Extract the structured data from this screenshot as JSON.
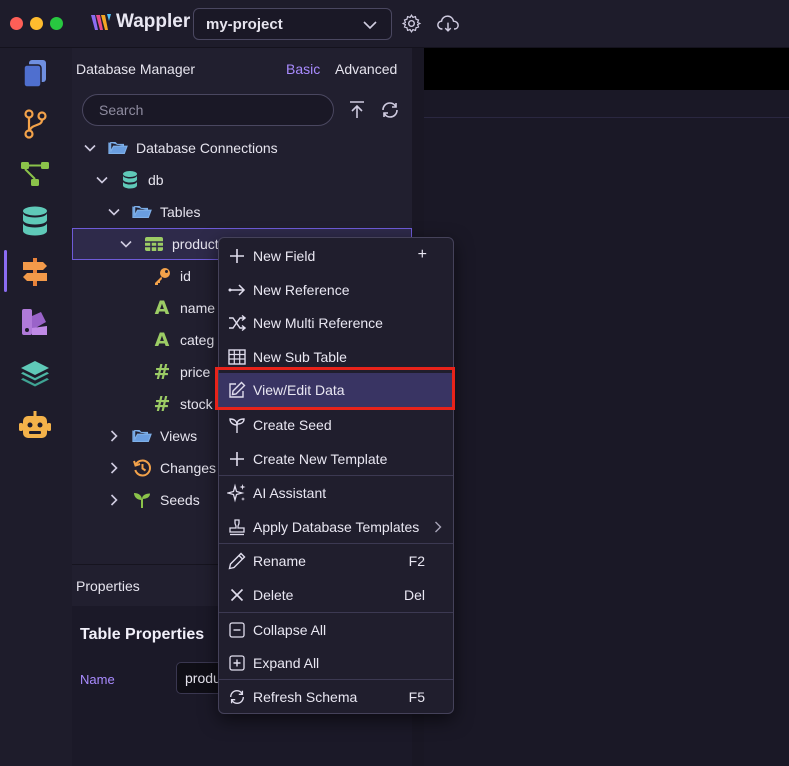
{
  "titlebar": {
    "app_name": "Wappler",
    "project": "my-project"
  },
  "panel": {
    "title": "Database Manager",
    "mode_basic": "Basic",
    "mode_advanced": "Advanced",
    "search_placeholder": "Search"
  },
  "tree": {
    "connections": "Database Connections",
    "db": "db",
    "tables": "Tables",
    "table_name": "product",
    "fields": [
      {
        "name": "id",
        "type": "key"
      },
      {
        "name": "name",
        "type": "text"
      },
      {
        "name": "categ",
        "type": "text"
      },
      {
        "name": "price",
        "type": "number"
      },
      {
        "name": "stock",
        "type": "number"
      }
    ],
    "views": "Views",
    "changes": "Changes",
    "seeds": "Seeds"
  },
  "properties": {
    "header": "Properties",
    "title": "Table Properties",
    "name_label": "Name",
    "name_value": "produ"
  },
  "context_menu": {
    "items": [
      {
        "label": "New Field",
        "shortcut": "+",
        "icon": "plus-icon"
      },
      {
        "label": "New Reference",
        "shortcut": "",
        "icon": "arrow-right-icon"
      },
      {
        "label": "New Multi Reference",
        "shortcut": "",
        "icon": "shuffle-icon"
      },
      {
        "label": "New Sub Table",
        "shortcut": "",
        "icon": "table-icon"
      },
      {
        "label": "View/Edit Data",
        "shortcut": "",
        "icon": "edit-icon"
      },
      {
        "label": "Create Seed",
        "shortcut": "",
        "icon": "seedling-icon"
      },
      {
        "label": "Create New Template",
        "shortcut": "",
        "icon": "plus-icon"
      },
      {
        "label": "AI Assistant",
        "shortcut": "",
        "icon": "sparkles-icon"
      },
      {
        "label": "Apply Database Templates",
        "shortcut": "",
        "icon": "stamp-icon"
      },
      {
        "label": "Rename",
        "shortcut": "F2",
        "icon": "pencil-icon"
      },
      {
        "label": "Delete",
        "shortcut": "Del",
        "icon": "x-icon"
      },
      {
        "label": "Collapse All",
        "shortcut": "",
        "icon": "minus-square-icon"
      },
      {
        "label": "Expand All",
        "shortcut": "",
        "icon": "plus-square-icon"
      },
      {
        "label": "Refresh Schema",
        "shortcut": "F5",
        "icon": "refresh-icon"
      }
    ]
  },
  "colors": {
    "accent": "#a98bff",
    "highlight_box": "#e8231a",
    "menu_hover": "#393463"
  }
}
